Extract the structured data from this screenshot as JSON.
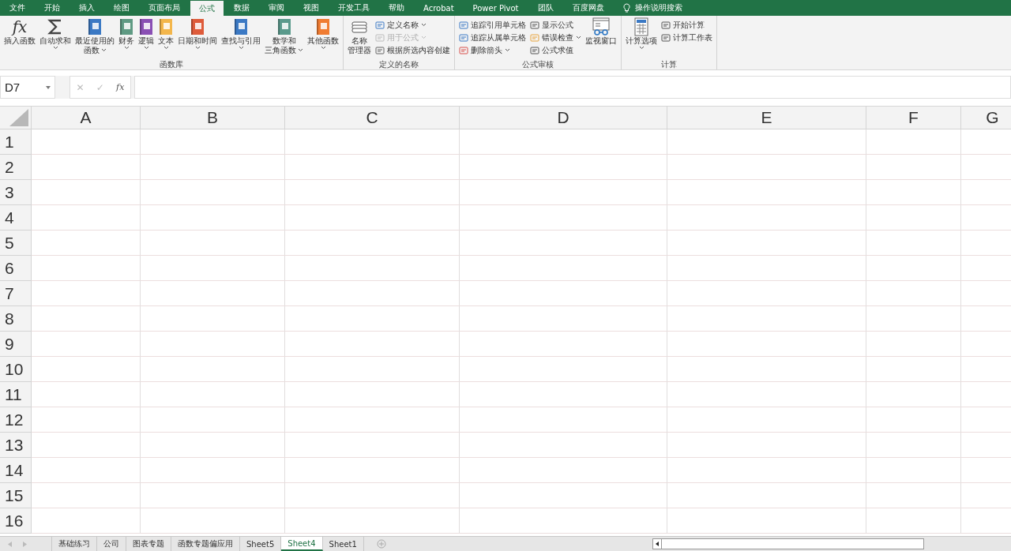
{
  "menu_tabs": [
    {
      "label": "文件",
      "selected": false
    },
    {
      "label": "开始",
      "selected": false
    },
    {
      "label": "插入",
      "selected": false
    },
    {
      "label": "绘图",
      "selected": false
    },
    {
      "label": "页面布局",
      "selected": false
    },
    {
      "label": "公式",
      "selected": true
    },
    {
      "label": "数据",
      "selected": false
    },
    {
      "label": "审阅",
      "selected": false
    },
    {
      "label": "视图",
      "selected": false
    },
    {
      "label": "开发工具",
      "selected": false
    },
    {
      "label": "帮助",
      "selected": false
    },
    {
      "label": "Acrobat",
      "selected": false
    },
    {
      "label": "Power Pivot",
      "selected": false
    },
    {
      "label": "团队",
      "selected": false
    },
    {
      "label": "百度网盘",
      "selected": false
    }
  ],
  "tell_me": {
    "placeholder": "操作说明搜索"
  },
  "ribbon": {
    "groups": [
      {
        "label": "函数库",
        "items": [
          {
            "kind": "large",
            "label": "插入函数",
            "glyph": "fx",
            "dropdown": false,
            "disabled": false
          },
          {
            "kind": "large",
            "label": "自动求和",
            "dropdown": true,
            "disabled": false
          },
          {
            "kind": "large",
            "label": [
              "最近使用的",
              "函数"
            ],
            "dropdown": true,
            "disabled": false
          },
          {
            "kind": "large",
            "label": "财务",
            "dropdown": true,
            "disabled": false
          },
          {
            "kind": "large",
            "label": "逻辑",
            "dropdown": true,
            "disabled": false
          },
          {
            "kind": "large",
            "label": "文本",
            "dropdown": true,
            "disabled": false
          },
          {
            "kind": "large",
            "label": "日期和时间",
            "dropdown": true,
            "disabled": false
          },
          {
            "kind": "large",
            "label": "查找与引用",
            "dropdown": true,
            "disabled": false
          },
          {
            "kind": "large",
            "label": [
              "数学和",
              "三角函数"
            ],
            "dropdown": true,
            "disabled": false
          },
          {
            "kind": "large",
            "label": "其他函数",
            "dropdown": true,
            "disabled": false
          }
        ]
      },
      {
        "label": "定义的名称",
        "items": [
          {
            "kind": "large",
            "label": [
              "名称",
              "管理器"
            ],
            "dropdown": false,
            "disabled": false
          },
          {
            "kind": "stack",
            "items": [
              {
                "label": "定义名称",
                "dropdown": true,
                "disabled": false
              },
              {
                "label": "用于公式",
                "dropdown": true,
                "disabled": true
              },
              {
                "label": "根据所选内容创建",
                "dropdown": false,
                "disabled": false
              }
            ]
          }
        ]
      },
      {
        "label": "公式审核",
        "items": [
          {
            "kind": "stack",
            "items": [
              {
                "label": "追踪引用单元格",
                "dropdown": false,
                "disabled": false
              },
              {
                "label": "追踪从属单元格",
                "dropdown": false,
                "disabled": false
              },
              {
                "label": "删除箭头",
                "dropdown": true,
                "disabled": false
              }
            ]
          },
          {
            "kind": "stack",
            "items": [
              {
                "label": "显示公式",
                "dropdown": false,
                "disabled": false
              },
              {
                "label": "错误检查",
                "dropdown": true,
                "disabled": false
              },
              {
                "label": "公式求值",
                "dropdown": false,
                "disabled": false
              }
            ]
          },
          {
            "kind": "large",
            "label": "监视窗口",
            "dropdown": false,
            "disabled": false
          }
        ]
      },
      {
        "label": "计算",
        "items": [
          {
            "kind": "large",
            "label": "计算选项",
            "dropdown": true,
            "disabled": false
          },
          {
            "kind": "stack",
            "items": [
              {
                "label": "开始计算",
                "dropdown": false,
                "disabled": false
              },
              {
                "label": "计算工作表",
                "dropdown": false,
                "disabled": false
              }
            ]
          }
        ]
      }
    ]
  },
  "formula_bar": {
    "name_box": "D7",
    "cancel": "✕",
    "enter": "✓",
    "insert_function": "fx"
  },
  "sheet": {
    "columns": [
      "A",
      "B",
      "C",
      "D",
      "E",
      "F",
      "G"
    ],
    "rows": [
      "1",
      "2",
      "3",
      "4",
      "5",
      "6",
      "7",
      "8",
      "9",
      "10",
      "11",
      "12",
      "13",
      "14",
      "15",
      "16"
    ]
  },
  "sheet_tabs": [
    {
      "label": "基础练习",
      "selected": false
    },
    {
      "label": "公司",
      "selected": false
    },
    {
      "label": "图表专题",
      "selected": false
    },
    {
      "label": "函数专题偏应用",
      "selected": false
    },
    {
      "label": "Sheet5",
      "selected": false
    },
    {
      "label": "Sheet4",
      "selected": true
    },
    {
      "label": "Sheet1",
      "selected": false
    }
  ]
}
